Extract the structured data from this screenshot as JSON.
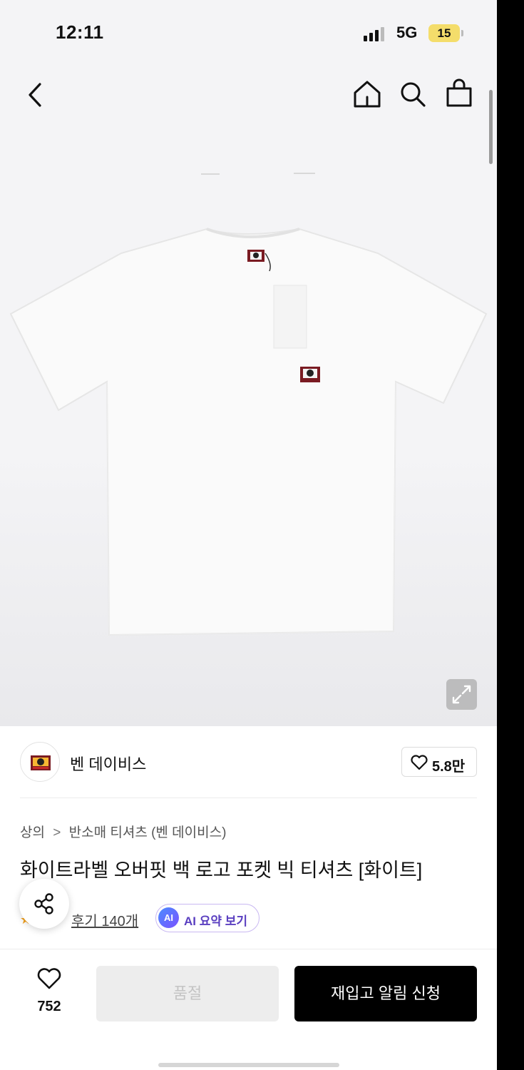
{
  "status_bar": {
    "time": "12:11",
    "network": "5G",
    "battery": "15"
  },
  "nav": {
    "back_icon": "chevron-left-icon",
    "home_icon": "home-icon",
    "search_icon": "search-icon",
    "cart_icon": "shopping-bag-icon"
  },
  "hero": {
    "image_subject": "white t-shirt product photo",
    "zoom_icon": "expand-icon"
  },
  "brand": {
    "name": "벤 데이비스",
    "like_count": "5.8만",
    "heart_icon": "heart-icon"
  },
  "breadcrumb": {
    "category": "상의",
    "separator": ">",
    "subcategory": "반소매 티셔츠 (벤 데이비스)"
  },
  "product": {
    "title": "화이트라벨 오버핏 백 로고 포켓 빅 티셔츠 [화이트]"
  },
  "reviews": {
    "link_label": "후기 140개",
    "ai_badge": "AI",
    "ai_summary_label": "AI 요약 보기"
  },
  "share": {
    "icon": "share-icon"
  },
  "bottom_bar": {
    "wish_count": "752",
    "soldout_label": "품절",
    "restock_label": "재입고 알림 신청"
  },
  "colors": {
    "primary_button": "#000000",
    "disabled_button": "#ededed",
    "ai_accent": "#5a3fc0",
    "battery": "#f4dd6b"
  }
}
